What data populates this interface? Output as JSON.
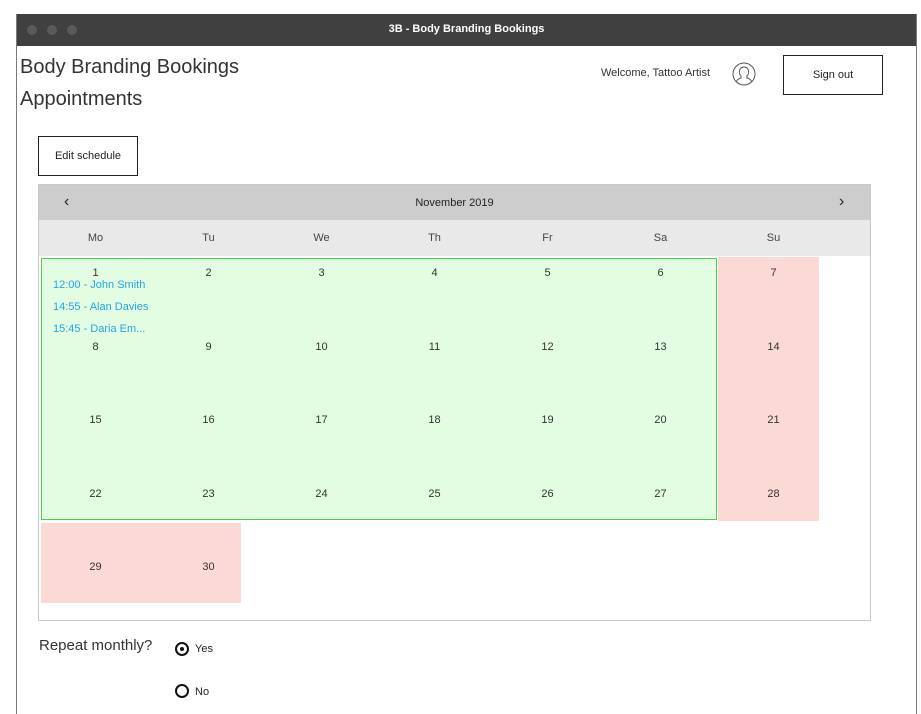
{
  "window": {
    "title": "3B - Body Branding Bookings"
  },
  "header": {
    "app_title": "Body Branding Bookings",
    "page_title": "Appointments",
    "welcome": "Welcome, Tattoo Artist",
    "sign_out": "Sign out"
  },
  "toolbar": {
    "edit_schedule": "Edit schedule"
  },
  "calendar": {
    "month": "November 2019",
    "prev": "‹",
    "next": "›",
    "weekdays": [
      "Mo",
      "Tu",
      "We",
      "Th",
      "Fr",
      "Sa",
      "Su"
    ],
    "days": [
      "1",
      "2",
      "3",
      "4",
      "5",
      "6",
      "7",
      "8",
      "9",
      "10",
      "11",
      "12",
      "13",
      "14",
      "15",
      "16",
      "17",
      "18",
      "19",
      "20",
      "21",
      "22",
      "23",
      "24",
      "25",
      "26",
      "27",
      "28",
      "29",
      "30"
    ],
    "appointments": [
      {
        "text": "12:00 - John Smith"
      },
      {
        "text": "14:55 - Alan Davies"
      },
      {
        "text": "15:45 - Daria Em..."
      }
    ],
    "colors": {
      "available": "#e3fde3",
      "available_border": "#4ccf4c",
      "unavailable": "#fbd9d5",
      "appointment": "#22a6e0"
    }
  },
  "repeat": {
    "label": "Repeat monthly?",
    "options": [
      {
        "label": "Yes",
        "selected": true
      },
      {
        "label": "No",
        "selected": false
      }
    ]
  },
  "icons": {
    "avatar": "user-circle-icon"
  }
}
